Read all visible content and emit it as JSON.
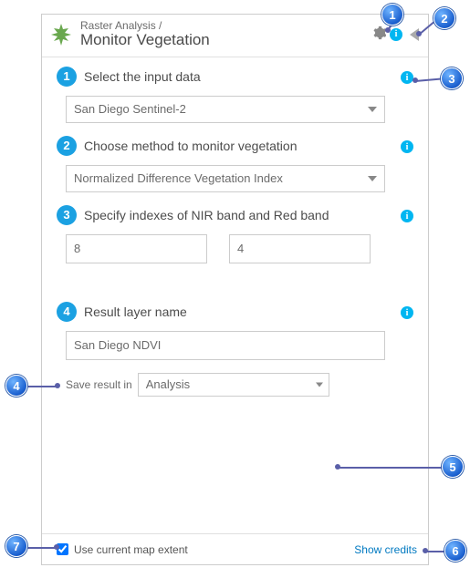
{
  "header": {
    "breadcrumb": "Raster Analysis /",
    "title": "Monitor Vegetation"
  },
  "sections": {
    "s1": {
      "num": "1",
      "label": "Select the input data",
      "value": "San Diego Sentinel-2"
    },
    "s2": {
      "num": "2",
      "label": "Choose method to monitor vegetation",
      "value": "Normalized Difference Vegetation Index"
    },
    "s3": {
      "num": "3",
      "label": "Specify indexes of NIR band and Red band",
      "nir": "8",
      "red": "4"
    },
    "s4": {
      "num": "4",
      "label": "Result layer name",
      "value": "San Diego NDVI",
      "save_label": "Save result in",
      "save_value": "Analysis"
    }
  },
  "footer": {
    "extent_label": "Use current map extent",
    "show_credits": "Show credits"
  },
  "callouts": {
    "c1": "1",
    "c2": "2",
    "c3": "3",
    "c4": "4",
    "c5": "5",
    "c6": "6",
    "c7": "7"
  }
}
